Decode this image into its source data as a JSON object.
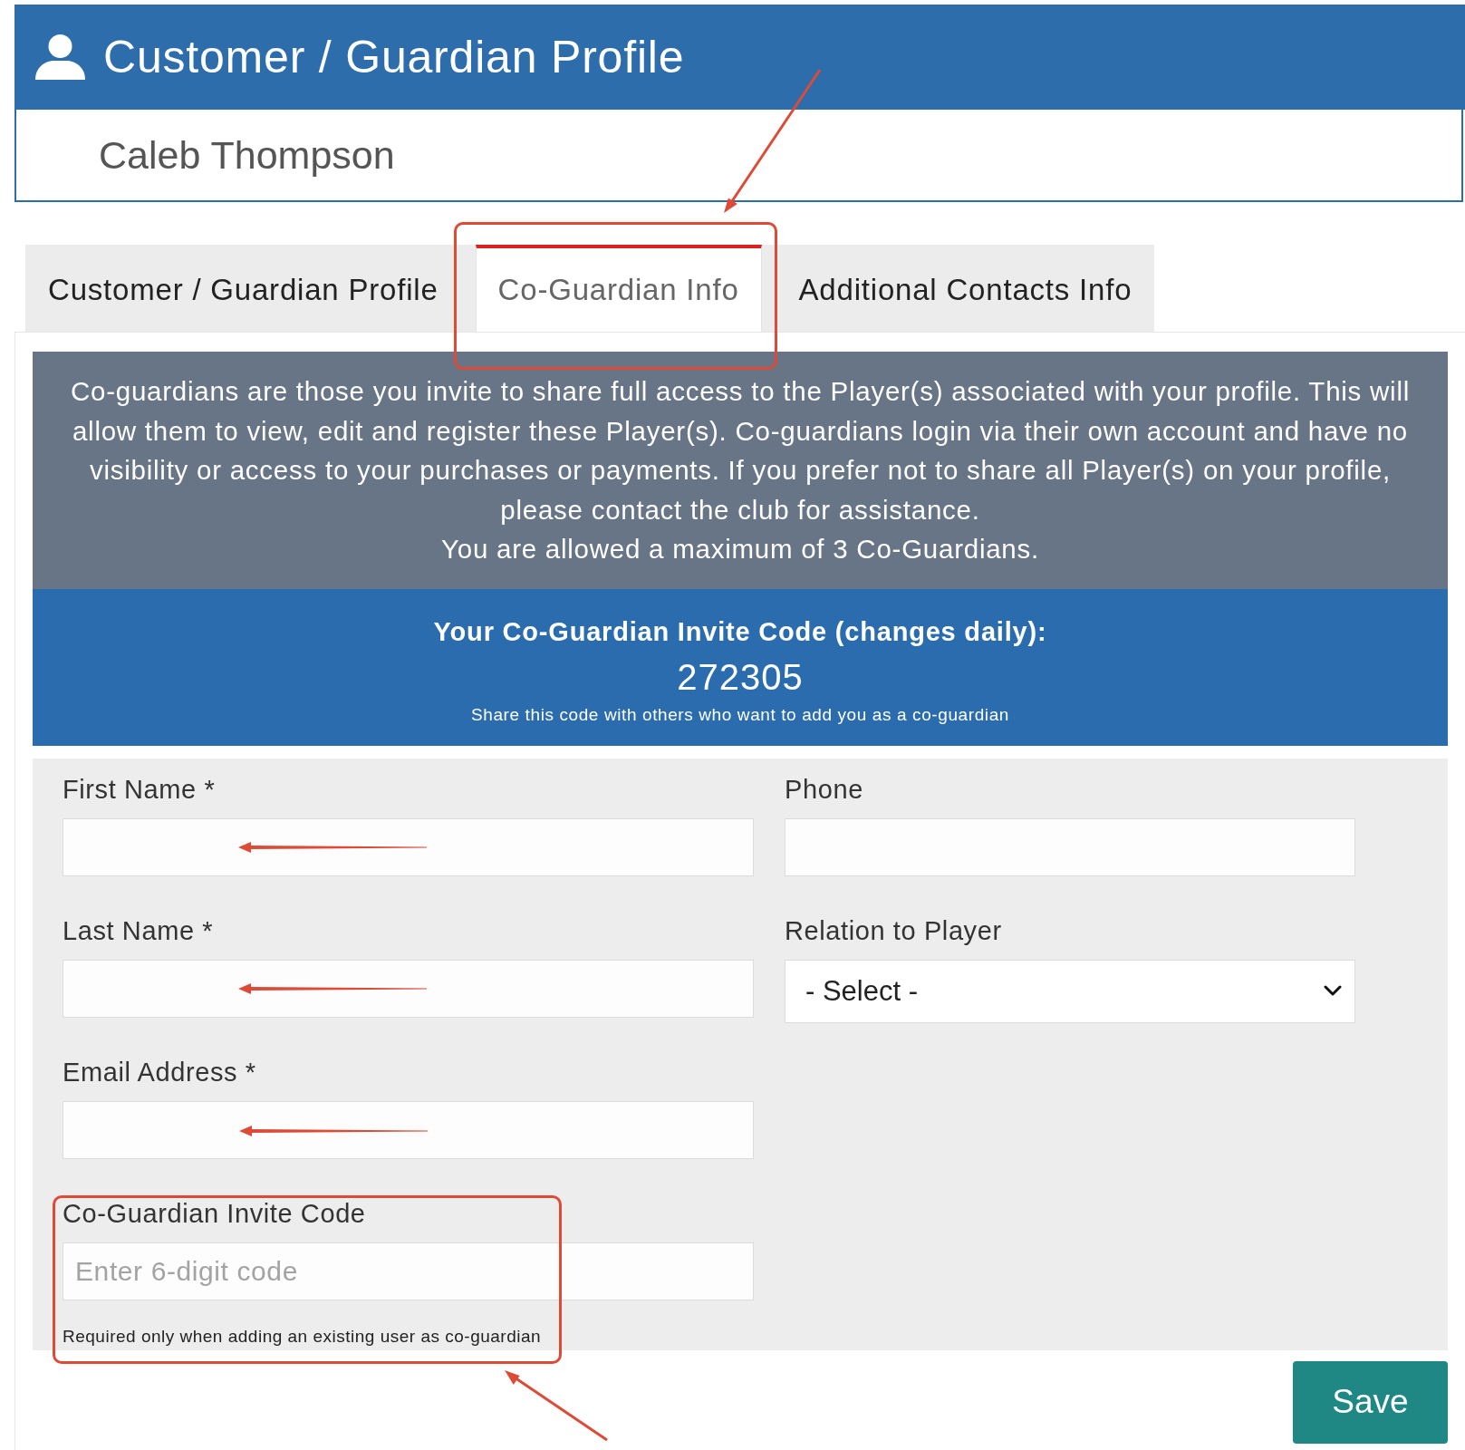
{
  "header": {
    "title": "Customer / Guardian Profile"
  },
  "customer": {
    "name": "Caleb Thompson"
  },
  "tabs": [
    {
      "label": "Customer / Guardian Profile",
      "selected": false
    },
    {
      "label": "Co-Guardian Info",
      "selected": true
    },
    {
      "label": "Additional Contacts Info",
      "selected": false
    }
  ],
  "info": {
    "paragraph": "Co-guardians are those you invite to share full access to the Player(s) associated with your profile. This will allow them to view, edit and register these Player(s). Co-guardians login via their own account and have no visibility or access to your purchases or payments. If you prefer not to share all Player(s) on your profile, please contact the club for assistance.",
    "limit_note": "You are allowed a maximum of 3 Co-Guardians."
  },
  "invite_code": {
    "heading": "Your Co-Guardian Invite Code (changes daily):",
    "code": "272305",
    "note": "Share this code with others who want to add you as a co-guardian"
  },
  "form": {
    "columns": [
      {
        "fields": [
          {
            "kind": "text",
            "label": "First Name *"
          },
          {
            "kind": "text",
            "label": "Last Name *"
          },
          {
            "kind": "text",
            "label": "Email Address *"
          },
          {
            "kind": "text",
            "label": "Co-Guardian Invite Code",
            "placeholder": "Enter 6-digit code",
            "help_text": "Required only when adding an existing user as co-guardian"
          }
        ]
      },
      {
        "fields": [
          {
            "kind": "text",
            "label": "Phone"
          },
          {
            "kind": "select",
            "label": "Relation to Player",
            "value": "- Select -"
          }
        ]
      }
    ]
  },
  "save_button": {
    "label": "Save"
  }
}
